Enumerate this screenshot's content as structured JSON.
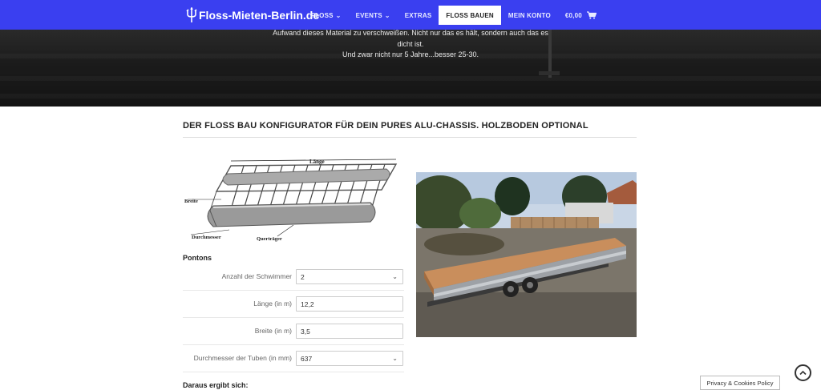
{
  "header": {
    "logo_text": "Floss-Mieten-Berlin.de",
    "nav": [
      {
        "label": "FLOSS",
        "dropdown": true
      },
      {
        "label": "EVENTS",
        "dropdown": true
      },
      {
        "label": "EXTRAS",
        "dropdown": false
      },
      {
        "label": "FLOSS BAUEN",
        "dropdown": false,
        "active": true
      },
      {
        "label": "MEIN KONTO",
        "dropdown": false
      }
    ],
    "cart_total": "€0,00",
    "colors": {
      "bar": "#3a3ff0",
      "active_bg": "#ffffff"
    }
  },
  "hero": {
    "lines": [
      "Aufwand dieses Material zu verschweißen. Nicht nur das es hält, sondern auch das es",
      "dicht ist.",
      "Und zwar nicht nur 5 Jahre...besser 25-30."
    ]
  },
  "main": {
    "title": "DER FLOSS BAU KONFIGURATOR FÜR DEIN PURES ALU-CHASSIS. HOLZBODEN OPTIONAL",
    "diagram_labels": {
      "length": "Länge",
      "width": "Breite",
      "diameter": "Durchmesser",
      "crossbeam": "Querträger"
    },
    "pontons_heading": "Pontons",
    "fields": [
      {
        "label": "Anzahl der Schwimmer",
        "value": "2",
        "type": "select"
      },
      {
        "label": "Länge (in m)",
        "value": "12,2",
        "type": "input"
      },
      {
        "label": "Breite (in m)",
        "value": "3,5",
        "type": "input"
      },
      {
        "label": "Durchmesser der Tuben (in mm)",
        "value": "637",
        "type": "select"
      }
    ],
    "result_heading": "Daraus ergibt sich:"
  },
  "footer": {
    "privacy_label": "Privacy & Cookies Policy"
  }
}
